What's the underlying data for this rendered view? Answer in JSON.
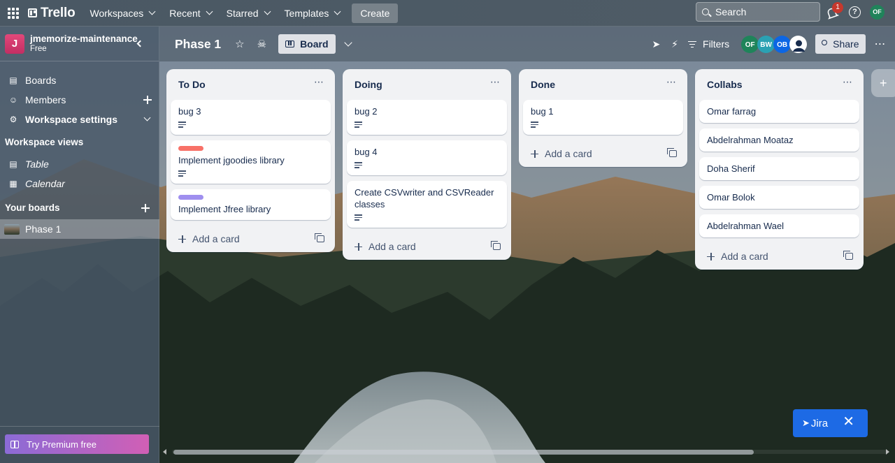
{
  "topbar": {
    "brand": "Trello",
    "nav": [
      "Workspaces",
      "Recent",
      "Starred",
      "Templates"
    ],
    "create_label": "Create",
    "search_placeholder": "Search",
    "notification_count": "1",
    "help_label": "?",
    "user_initials": "OF"
  },
  "sidebar": {
    "workspace_initial": "J",
    "workspace_name": "jmemorize-maintenance",
    "workspace_plan": "Free",
    "items": [
      {
        "label": "Boards",
        "icon": "board-icon"
      },
      {
        "label": "Members",
        "icon": "person-icon"
      },
      {
        "label": "Workspace settings",
        "icon": "gear-icon"
      }
    ],
    "views_heading": "Workspace views",
    "views": [
      {
        "label": "Table",
        "icon": "table-icon"
      },
      {
        "label": "Calendar",
        "icon": "calendar-icon"
      }
    ],
    "boards_heading": "Your boards",
    "boards": [
      {
        "label": "Phase 1"
      }
    ],
    "premium_label": "Try Premium free"
  },
  "board": {
    "title": "Phase 1",
    "view_label": "Board",
    "filters_label": "Filters",
    "share_label": "Share",
    "members": [
      {
        "initials": "OF",
        "color": "#1f845a"
      },
      {
        "initials": "BW",
        "color": "#2aa1b3"
      },
      {
        "initials": "OB",
        "color": "#0c66e4"
      },
      {
        "initials": "",
        "color": "#ffffff"
      }
    ]
  },
  "lists": [
    {
      "title": "To Do",
      "cards": [
        {
          "title": "bug 3",
          "label_color": "",
          "has_description": true
        },
        {
          "title": "Implement jgoodies library",
          "label_color": "#f87168",
          "has_description": true
        },
        {
          "title": "Implement Jfree library",
          "label_color": "#9f8fef",
          "has_description": false
        }
      ],
      "add_label": "Add a card"
    },
    {
      "title": "Doing",
      "cards": [
        {
          "title": "bug 2",
          "label_color": "",
          "has_description": true
        },
        {
          "title": "bug 4",
          "label_color": "",
          "has_description": true
        },
        {
          "title": "Create CSVwriter and CSVReader classes",
          "label_color": "",
          "has_description": true
        }
      ],
      "add_label": "Add a card"
    },
    {
      "title": "Done",
      "cards": [
        {
          "title": "bug 1",
          "label_color": "",
          "has_description": true
        }
      ],
      "add_label": "Add a card"
    },
    {
      "title": "Collabs",
      "cards": [
        {
          "title": "Omar farrag",
          "label_color": "",
          "has_description": false
        },
        {
          "title": "Abdelrahman Moataz",
          "label_color": "",
          "has_description": false
        },
        {
          "title": "Doha Sherif",
          "label_color": "",
          "has_description": false
        },
        {
          "title": "Omar Bolok",
          "label_color": "",
          "has_description": false
        },
        {
          "title": "Abdelrahman Wael",
          "label_color": "",
          "has_description": false
        }
      ],
      "add_label": "Add a card"
    }
  ],
  "jira": {
    "label": "Jira",
    "close_label": "✕"
  }
}
